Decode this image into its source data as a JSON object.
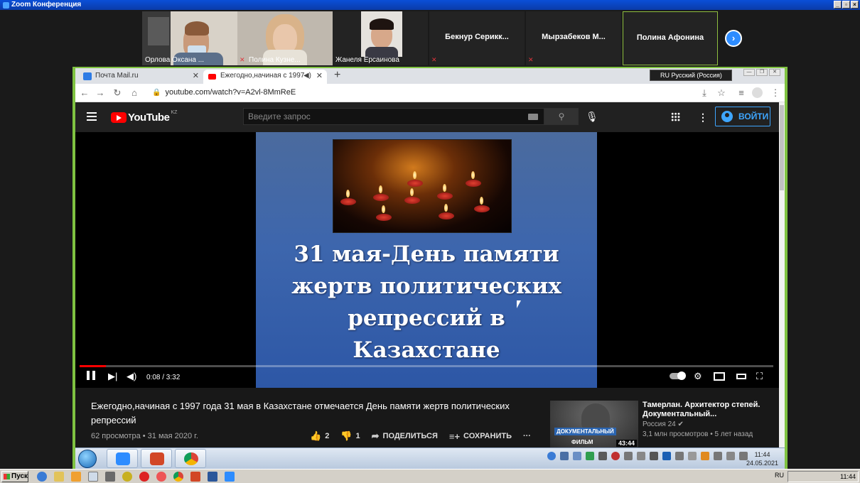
{
  "zoom": {
    "window_title": "Zoom Конференция",
    "participants": [
      {
        "name": "Орлова Оксана ...",
        "has_video": true,
        "muted": false
      },
      {
        "name": "Полина Кузне...",
        "has_video": true,
        "muted": true
      },
      {
        "name": "Жанеля Ерсаинова",
        "has_video": true,
        "muted": false
      },
      {
        "name": "Бекнур  Серикк...",
        "has_video": false,
        "muted": true
      },
      {
        "name": "Мырзабеков  М...",
        "has_video": false,
        "muted": true
      },
      {
        "name": "Полина Афонина",
        "has_video": false,
        "muted": false,
        "active_speaker": true
      }
    ],
    "next_icon": "chevron-right-icon",
    "accent_color": "#7fc241"
  },
  "browser": {
    "tabs": [
      {
        "title": "Почта Mail.ru",
        "favicon_color": "#2d7be5",
        "active": false
      },
      {
        "title": "Ежегодно,начиная с 1997 г",
        "favicon_color": "#ff0000",
        "active": true
      }
    ],
    "new_tab": "+",
    "language_indicator": "RU Русский (Россия)",
    "url": "youtube.com/watch?v=A2vl-8MmReE"
  },
  "youtube": {
    "logo_text": "YouTube",
    "region": "KZ",
    "search_placeholder": "Введите запрос",
    "signin_label": "ВОЙТИ",
    "brand_color": "#ff0000",
    "slide_text": [
      "31 мая-День памяти",
      "жертв политических",
      "репрессий в",
      "Казахстане"
    ],
    "time_display": "0:08 / 3:32",
    "progress_fraction": 0.038,
    "video_title": "Ежегодно,начиная с 1997 года 31 мая в Казахстане отмечается День памяти жертв политических репрессий",
    "video_meta": "62 просмотра • 31 мая 2020 г.",
    "likes": "2",
    "dislikes": "1",
    "share_label": "ПОДЕЛИТЬСЯ",
    "save_label": "СОХРАНИТЬ",
    "more_label": "···",
    "recommendation": {
      "title": "Тамерлан. Архитектор степей. Документальный...",
      "channel": "Россия 24",
      "stats": "3,1 млн просмотров • 5 лет назад",
      "badge_line1": "ДОКУМЕНТАЛЬНЫЙ",
      "badge_line2": "ФИЛЬМ",
      "duration": "43:44"
    }
  },
  "remote_taskbar": {
    "time": "11:44",
    "date": "24.05.2021"
  },
  "local_taskbar": {
    "start_label": "Пуск",
    "lang": "RU",
    "time": "11:44"
  }
}
